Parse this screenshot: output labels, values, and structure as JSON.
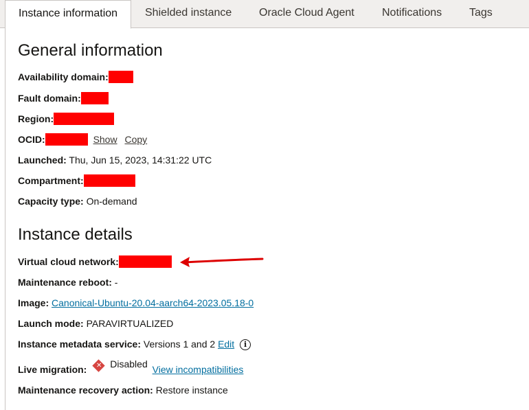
{
  "tabs": [
    {
      "label": "Instance information",
      "active": true
    },
    {
      "label": "Shielded instance"
    },
    {
      "label": "Oracle Cloud Agent"
    },
    {
      "label": "Notifications"
    },
    {
      "label": "Tags"
    }
  ],
  "general": {
    "heading": "General information",
    "availability_domain_label": "Availability domain:",
    "fault_domain_label": "Fault domain:",
    "region_label": "Region:",
    "ocid_label": "OCID:",
    "ocid_show": "Show",
    "ocid_copy": "Copy",
    "launched_label": "Launched:",
    "launched_value": "Thu, Jun 15, 2023, 14:31:22 UTC",
    "compartment_label": "Compartment:",
    "capacity_type_label": "Capacity type:",
    "capacity_type_value": "On-demand"
  },
  "details": {
    "heading": "Instance details",
    "vcn_label": "Virtual cloud network:",
    "maintenance_reboot_label": "Maintenance reboot:",
    "maintenance_reboot_value": "-",
    "image_label": "Image:",
    "image_value": "Canonical-Ubuntu-20.04-aarch64-2023.05.18-0",
    "launch_mode_label": "Launch mode:",
    "launch_mode_value": "PARAVIRTUALIZED",
    "metadata_label": "Instance metadata service:",
    "metadata_value": "Versions 1 and 2",
    "metadata_edit": "Edit",
    "live_migration_label": "Live migration:",
    "live_migration_value": "Disabled",
    "live_migration_link": "View incompatibilities",
    "recovery_label": "Maintenance recovery action:",
    "recovery_value": "Restore instance"
  },
  "colors": {
    "redaction": "#ff0000",
    "link": "#026e9f",
    "arrow": "#dd0000",
    "disabled_icon": "#d64541"
  },
  "icons": {
    "info": "info-circle-icon",
    "disabled": "disabled-diamond-icon",
    "annotation": "red-arrow-icon"
  }
}
